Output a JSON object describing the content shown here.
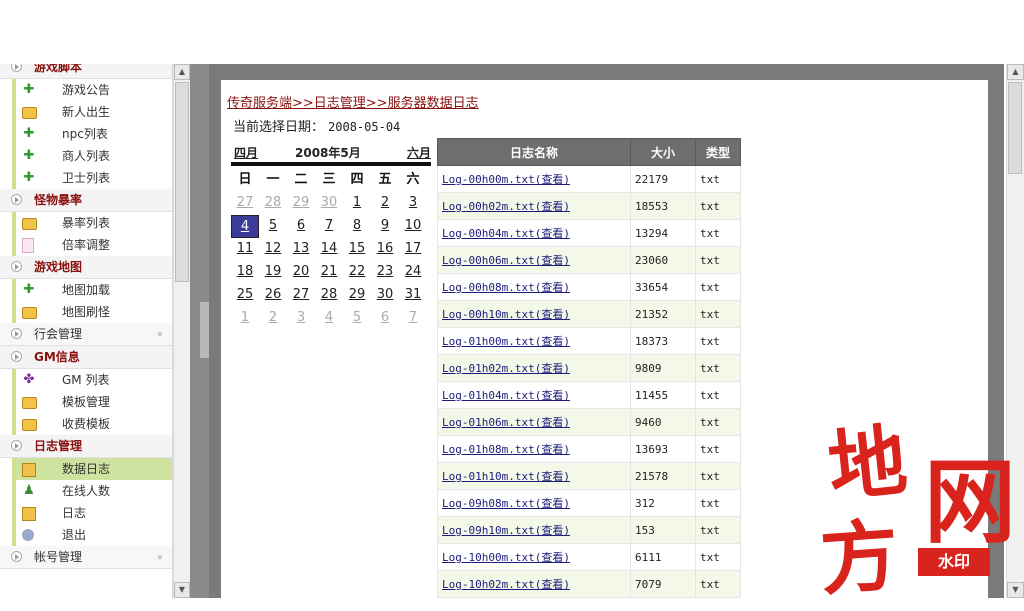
{
  "sidebar": {
    "sections": [
      {
        "title": "游戏脚本",
        "items": [
          {
            "label": "游戏公告",
            "icon": "plus-icon"
          },
          {
            "label": "新人出生",
            "icon": "folder-icon"
          },
          {
            "label": "npc列表",
            "icon": "plus-icon"
          },
          {
            "label": "商人列表",
            "icon": "plus-icon"
          },
          {
            "label": "卫士列表",
            "icon": "plus-icon"
          }
        ]
      },
      {
        "title": "怪物暴率",
        "items": [
          {
            "label": "暴率列表",
            "icon": "folder-icon"
          },
          {
            "label": "倍率调整",
            "icon": "page-icon"
          }
        ]
      },
      {
        "title": "游戏地图",
        "items": [
          {
            "label": "地图加载",
            "icon": "plus-icon"
          },
          {
            "label": "地图刷怪",
            "icon": "folder-icon"
          }
        ]
      },
      {
        "title": "行会管理",
        "collapsed": true,
        "items": []
      },
      {
        "title": "GM信息",
        "items": [
          {
            "label": "GM 列表",
            "icon": "puzzle-icon"
          },
          {
            "label": "模板管理",
            "icon": "folder-icon"
          },
          {
            "label": "收费模板",
            "icon": "folder-icon"
          }
        ]
      },
      {
        "title": "日志管理",
        "items": [
          {
            "label": "数据日志",
            "icon": "log-icon",
            "active": true
          },
          {
            "label": "在线人数",
            "icon": "users-icon"
          },
          {
            "label": "日志",
            "icon": "log-icon"
          },
          {
            "label": "退出",
            "icon": "exit-icon"
          }
        ]
      },
      {
        "title": "帐号管理",
        "collapsed": true,
        "items": []
      }
    ]
  },
  "breadcrumb": "传奇服务端>>日志管理>>服务器数据日志",
  "current_date": {
    "label": "当前选择日期：",
    "value": "2008-05-04"
  },
  "calendar": {
    "prev": "四月",
    "title": "2008年5月",
    "next": "六月",
    "weekdays": [
      "日",
      "一",
      "二",
      "三",
      "四",
      "五",
      "六"
    ],
    "weeks": [
      [
        "27",
        "28",
        "29",
        "30",
        "1",
        "2",
        "3"
      ],
      [
        "4",
        "5",
        "6",
        "7",
        "8",
        "9",
        "10"
      ],
      [
        "11",
        "12",
        "13",
        "14",
        "15",
        "16",
        "17"
      ],
      [
        "18",
        "19",
        "20",
        "21",
        "22",
        "23",
        "24"
      ],
      [
        "25",
        "26",
        "27",
        "28",
        "29",
        "30",
        "31"
      ],
      [
        "1",
        "2",
        "3",
        "4",
        "5",
        "6",
        "7"
      ]
    ],
    "selected": "4"
  },
  "log_table": {
    "headers": [
      "日志名称",
      "大小",
      "类型"
    ],
    "rows": [
      [
        "Log-00h00m.txt(查看)",
        "22179",
        "txt"
      ],
      [
        "Log-00h02m.txt(查看)",
        "18553",
        "txt"
      ],
      [
        "Log-00h04m.txt(查看)",
        "13294",
        "txt"
      ],
      [
        "Log-00h06m.txt(查看)",
        "23060",
        "txt"
      ],
      [
        "Log-00h08m.txt(查看)",
        "33654",
        "txt"
      ],
      [
        "Log-00h10m.txt(查看)",
        "21352",
        "txt"
      ],
      [
        "Log-01h00m.txt(查看)",
        "18373",
        "txt"
      ],
      [
        "Log-01h02m.txt(查看)",
        "9809",
        "txt"
      ],
      [
        "Log-01h04m.txt(查看)",
        "11455",
        "txt"
      ],
      [
        "Log-01h06m.txt(查看)",
        "9460",
        "txt"
      ],
      [
        "Log-01h08m.txt(查看)",
        "13693",
        "txt"
      ],
      [
        "Log-01h10m.txt(查看)",
        "21578",
        "txt"
      ],
      [
        "Log-09h08m.txt(查看)",
        "312",
        "txt"
      ],
      [
        "Log-09h10m.txt(查看)",
        "153",
        "txt"
      ],
      [
        "Log-10h00m.txt(查看)",
        "6111",
        "txt"
      ],
      [
        "Log-10h02m.txt(查看)",
        "7079",
        "txt"
      ]
    ]
  },
  "watermark": {
    "chars": [
      "地",
      "网",
      "方"
    ],
    "badge": "水印"
  },
  "colors": {
    "accent": "#8a1010",
    "active_item": "#cfe3a0",
    "header": "#6e6e6e",
    "watermark": "#d8241c"
  }
}
